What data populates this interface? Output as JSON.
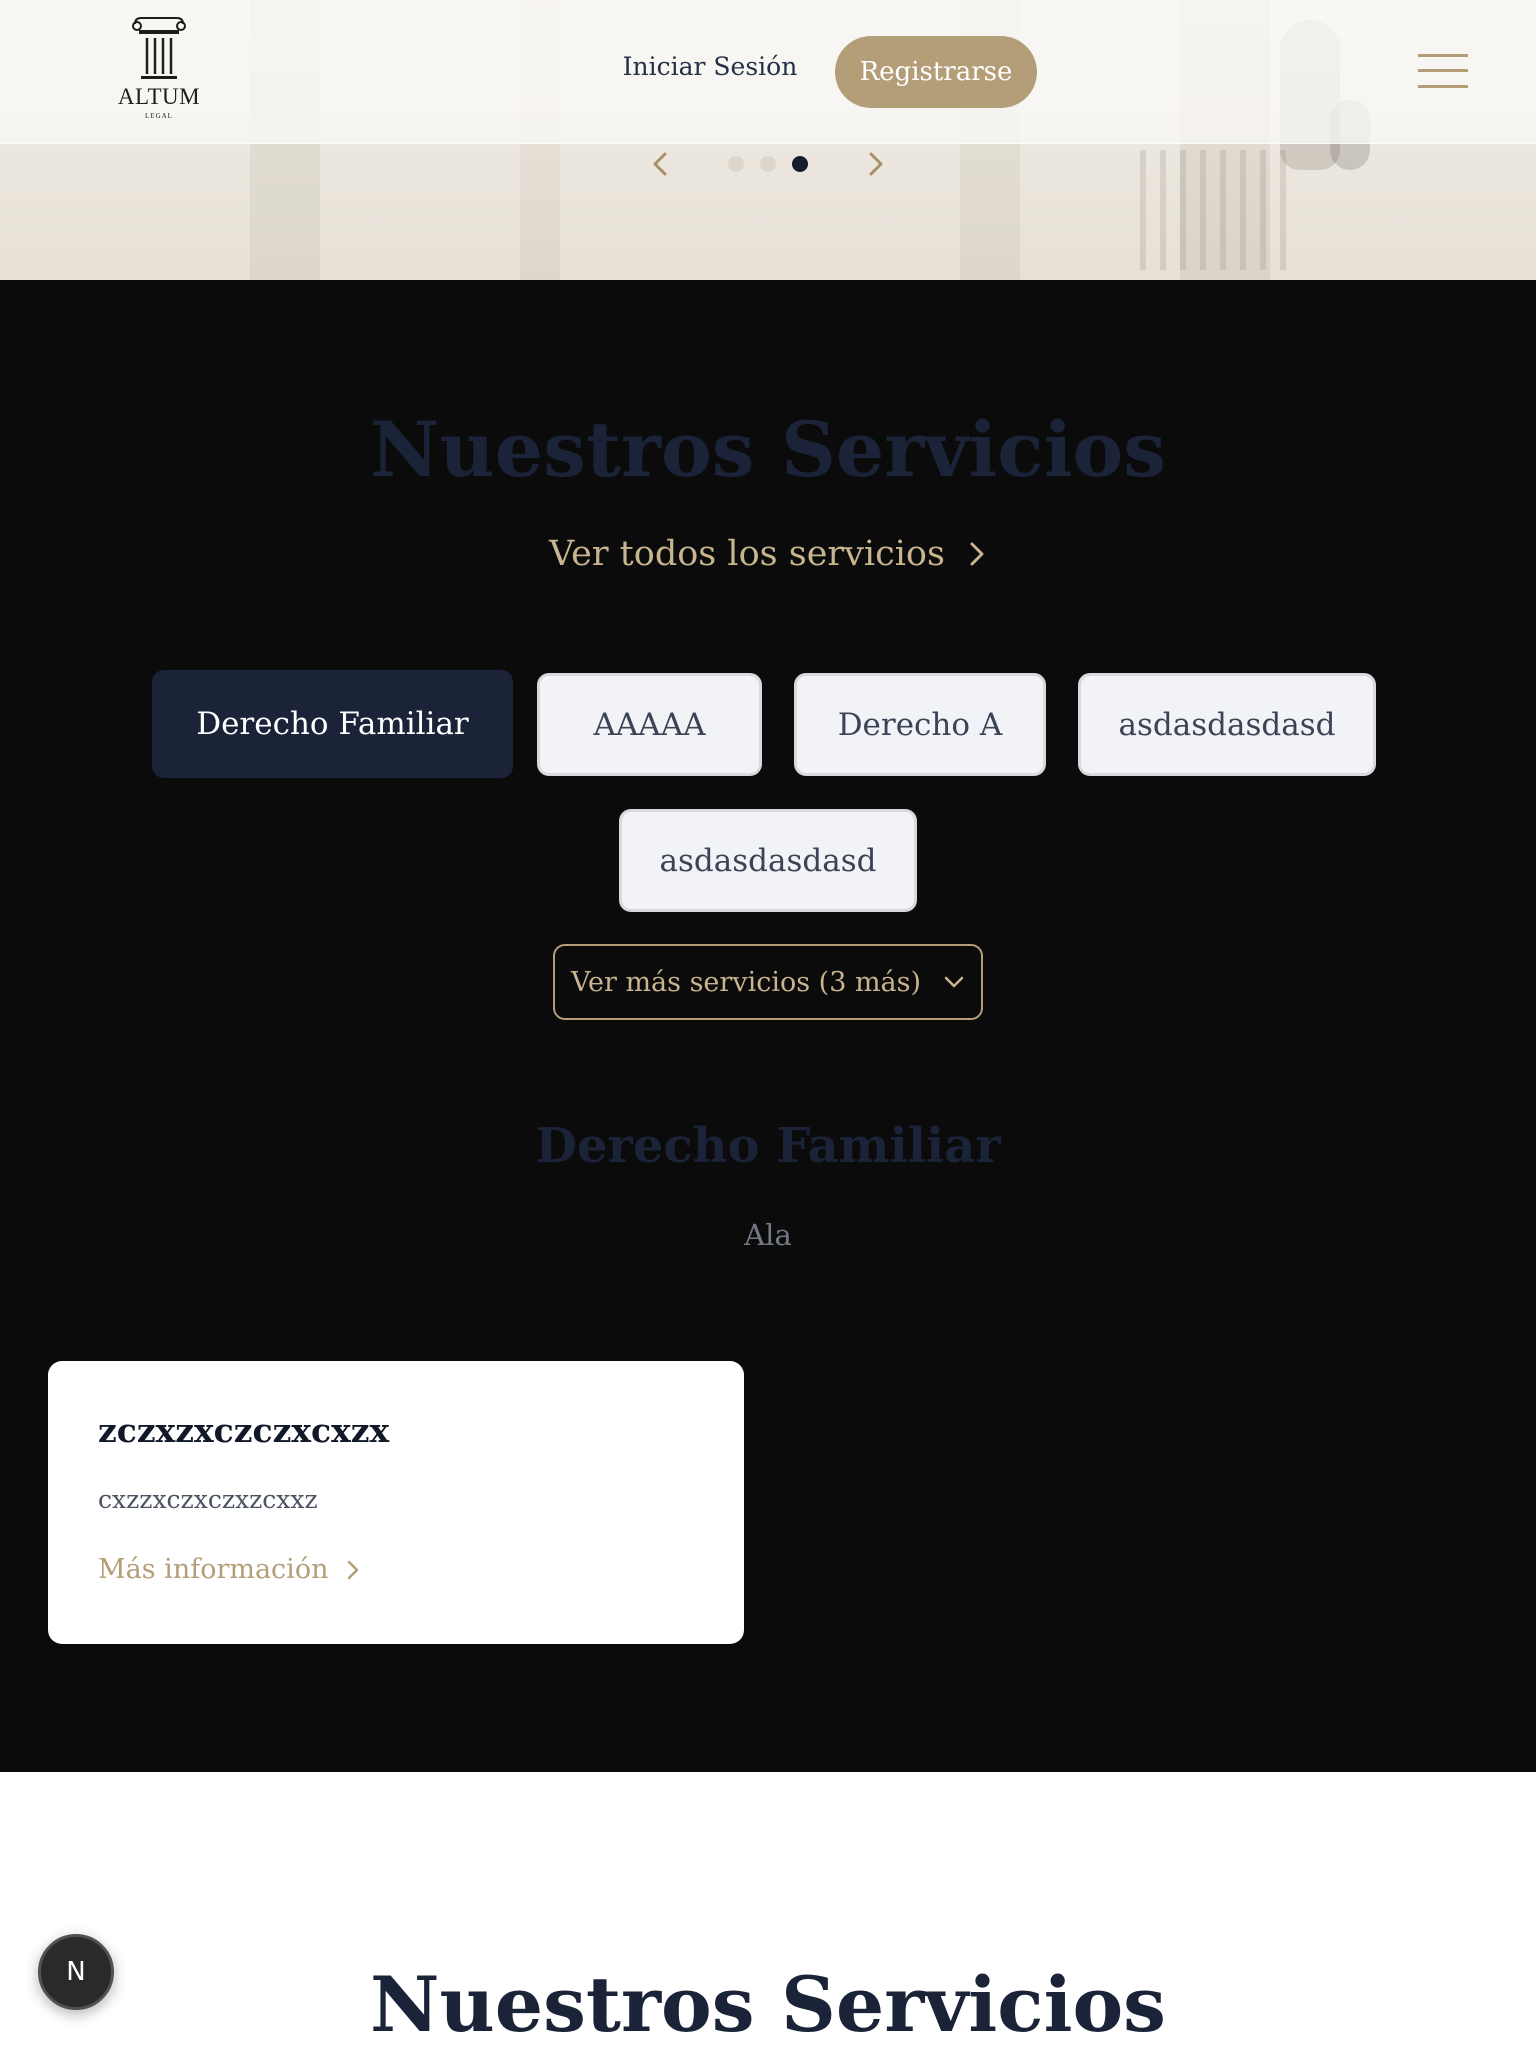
{
  "brand": {
    "name": "ALTUM",
    "tagline": "LEGAL",
    "logo_icon": "column-icon"
  },
  "nav": {
    "login_label": "Iniciar Sesión",
    "register_label": "Registrarse",
    "menu_icon": "hamburger-menu-icon"
  },
  "carousel": {
    "prev_icon": "chevron-left-icon",
    "next_icon": "chevron-right-icon",
    "slide_count": 3,
    "active_slide": 3
  },
  "services": {
    "title": "Nuestros Servicios",
    "view_all_label": "Ver todos los servicios",
    "categories": [
      {
        "label": "Derecho Familiar",
        "active": true
      },
      {
        "label": "AAAAA",
        "active": false
      },
      {
        "label": "Derecho A",
        "active": false
      },
      {
        "label": "asdasdasdasd",
        "active": false
      },
      {
        "label": "asdasdasdasd",
        "active": false
      }
    ],
    "more_label": "Ver más servicios (3 más)",
    "selected": {
      "title": "Derecho Familiar",
      "description": "Ala"
    },
    "cards": [
      {
        "title": "zczxzxczczxcxzx",
        "description": "cxzzxczxczxzcxxz",
        "link_label": "Más información"
      }
    ]
  },
  "bottom": {
    "title": "Nuestros Servicios"
  },
  "floating_badge": {
    "label": "N"
  },
  "colors": {
    "accent_gold": "#b39e78",
    "navy": "#1b2338",
    "dark_bg": "#0b0b0c"
  }
}
